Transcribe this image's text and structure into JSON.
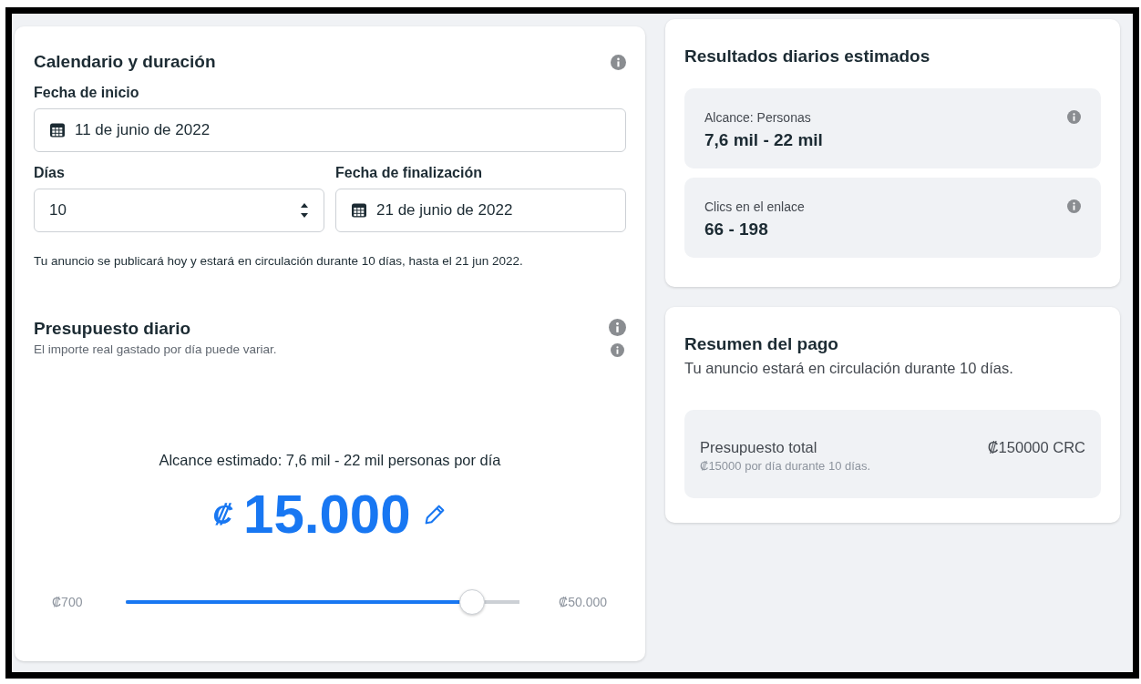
{
  "schedule": {
    "title": "Calendario y duración",
    "start_label": "Fecha de inicio",
    "start_value": "11 de junio de 2022",
    "days_label": "Días",
    "days_value": "10",
    "end_label": "Fecha de finalización",
    "end_value": "21 de junio de 2022",
    "note": "Tu anuncio se publicará hoy y estará en circulación durante 10 días, hasta el 21 jun 2022."
  },
  "budget": {
    "title": "Presupuesto diario",
    "subtitle": "El importe real gastado por día puede variar.",
    "reach": "Alcance estimado: 7,6 mil - 22 mil personas por día",
    "currency": "₡",
    "amount": "15.000",
    "slider": {
      "min": "₡700",
      "max": "₡50.000",
      "level": 0.88
    }
  },
  "results": {
    "title": "Resultados diarios estimados",
    "metrics": [
      {
        "label": "Alcance: Personas",
        "value": "7,6 mil - 22 mil"
      },
      {
        "label": "Clics en el enlace",
        "value": "66 - 198"
      }
    ]
  },
  "payment": {
    "title": "Resumen del pago",
    "subtitle": "Tu anuncio estará en circulación durante 10 días.",
    "total_label": "Presupuesto total",
    "total_value": "₡150000 CRC",
    "total_detail": "₡15000 por día durante 10 días."
  }
}
